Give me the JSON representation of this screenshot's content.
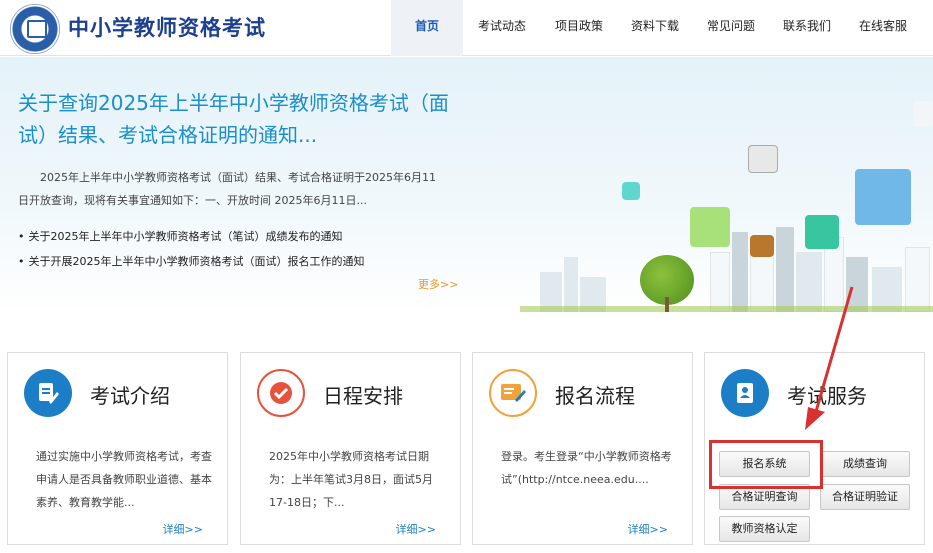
{
  "header": {
    "brand": "中小学教师资格考试",
    "nav": [
      {
        "label": "首页",
        "active": true
      },
      {
        "label": "考试动态",
        "active": false
      },
      {
        "label": "项目政策",
        "active": false
      },
      {
        "label": "资料下载",
        "active": false
      },
      {
        "label": "常见问题",
        "active": false
      },
      {
        "label": "联系我们",
        "active": false
      },
      {
        "label": "在线客服",
        "active": false
      }
    ]
  },
  "banner": {
    "title": "关于查询2025年上半年中小学教师资格考试（面试）结果、考试合格证明的通知...",
    "text": "2025年上半年中小学教师资格考试（面试）结果、考试合格证明于2025年6月11日开放查询，现将有关事宜通知如下：一、开放时间   2025年6月11日...",
    "links": [
      "关于2025年上半年中小学教师资格考试（笔试）成绩发布的通知",
      "关于开展2025年上半年中小学教师资格考试（面试）报名工作的通知"
    ],
    "more": "更多>>"
  },
  "cards": [
    {
      "title": "考试介绍",
      "text": "通过实施中小学教师资格考试，考查申请人是否具备教师职业道德、基本素养、教育教学能...",
      "more": "详细>>"
    },
    {
      "title": "日程安排",
      "text": "2025年中小学教师资格考试日期为：上半年笔试3月8日，面试5月17-18日；下...",
      "more": "详细>>"
    },
    {
      "title": "报名流程",
      "text": "登录。考生登录“中小学教师资格考试”(http://ntce.neea.edu....",
      "more": "详细>>"
    },
    {
      "title": "考试服务"
    }
  ],
  "services": [
    "报名系统",
    "成绩查询",
    "合格证明查询",
    "合格证明验证",
    "教师资格认定"
  ],
  "colors": {
    "accent": "#1a8fc9",
    "brand": "#1c3f8f",
    "highlight": "#d93030",
    "more": "#e39a2b"
  }
}
